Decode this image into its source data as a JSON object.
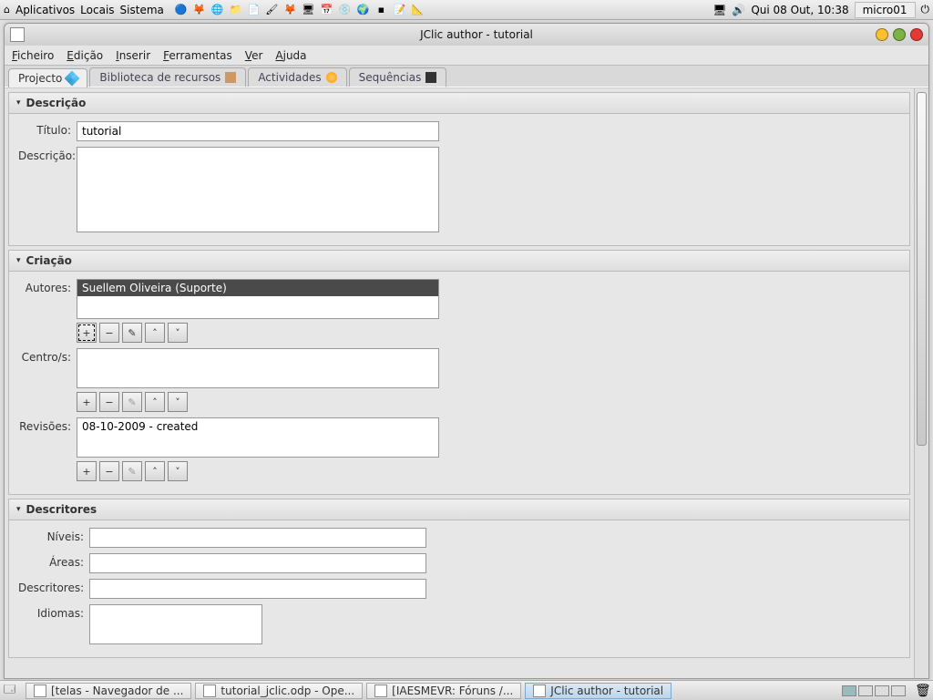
{
  "panel": {
    "sys_menus": [
      "Aplicativos",
      "Locais",
      "Sistema"
    ],
    "clock": "Qui 08 Out, 10:38",
    "user": "micro01"
  },
  "window": {
    "title": "JClic author - tutorial"
  },
  "menubar": {
    "file": "Ficheiro",
    "edit": "Edição",
    "insert": "Inserir",
    "tools": "Ferramentas",
    "view": "Ver",
    "help": "Ajuda",
    "file_u": "F",
    "edit_u": "E",
    "insert_u": "I",
    "tools_u": "F",
    "view_u": "V",
    "help_u": "A"
  },
  "tabs": {
    "project": "Projecto",
    "resources": "Biblioteca de recursos",
    "activities": "Actividades",
    "sequences": "Sequências"
  },
  "sections": {
    "description": {
      "title": "Descrição",
      "title_label": "Título:",
      "title_value": "tutorial",
      "desc_label": "Descrição:"
    },
    "creation": {
      "title": "Criação",
      "authors_label": "Autores:",
      "author_item": "Suellem Oliveira (Suporte)",
      "centers_label": "Centro/s:",
      "revisions_label": "Revisões:",
      "revision_item": "08-10-2009 - created"
    },
    "descriptors": {
      "title": "Descritores",
      "levels": "Níveis:",
      "areas": "Áreas:",
      "descriptors": "Descritores:",
      "languages": "Idiomas:"
    }
  },
  "buttons": {
    "add": "+",
    "remove": "−",
    "edit": "✎",
    "up": "˄",
    "down": "˅"
  },
  "taskbar": {
    "t1": "[telas - Navegador de ...",
    "t2": "tutorial_jclic.odp - Ope...",
    "t3": "[IAESMEVR: Fóruns /...",
    "t4": "JClic author - tutorial"
  }
}
